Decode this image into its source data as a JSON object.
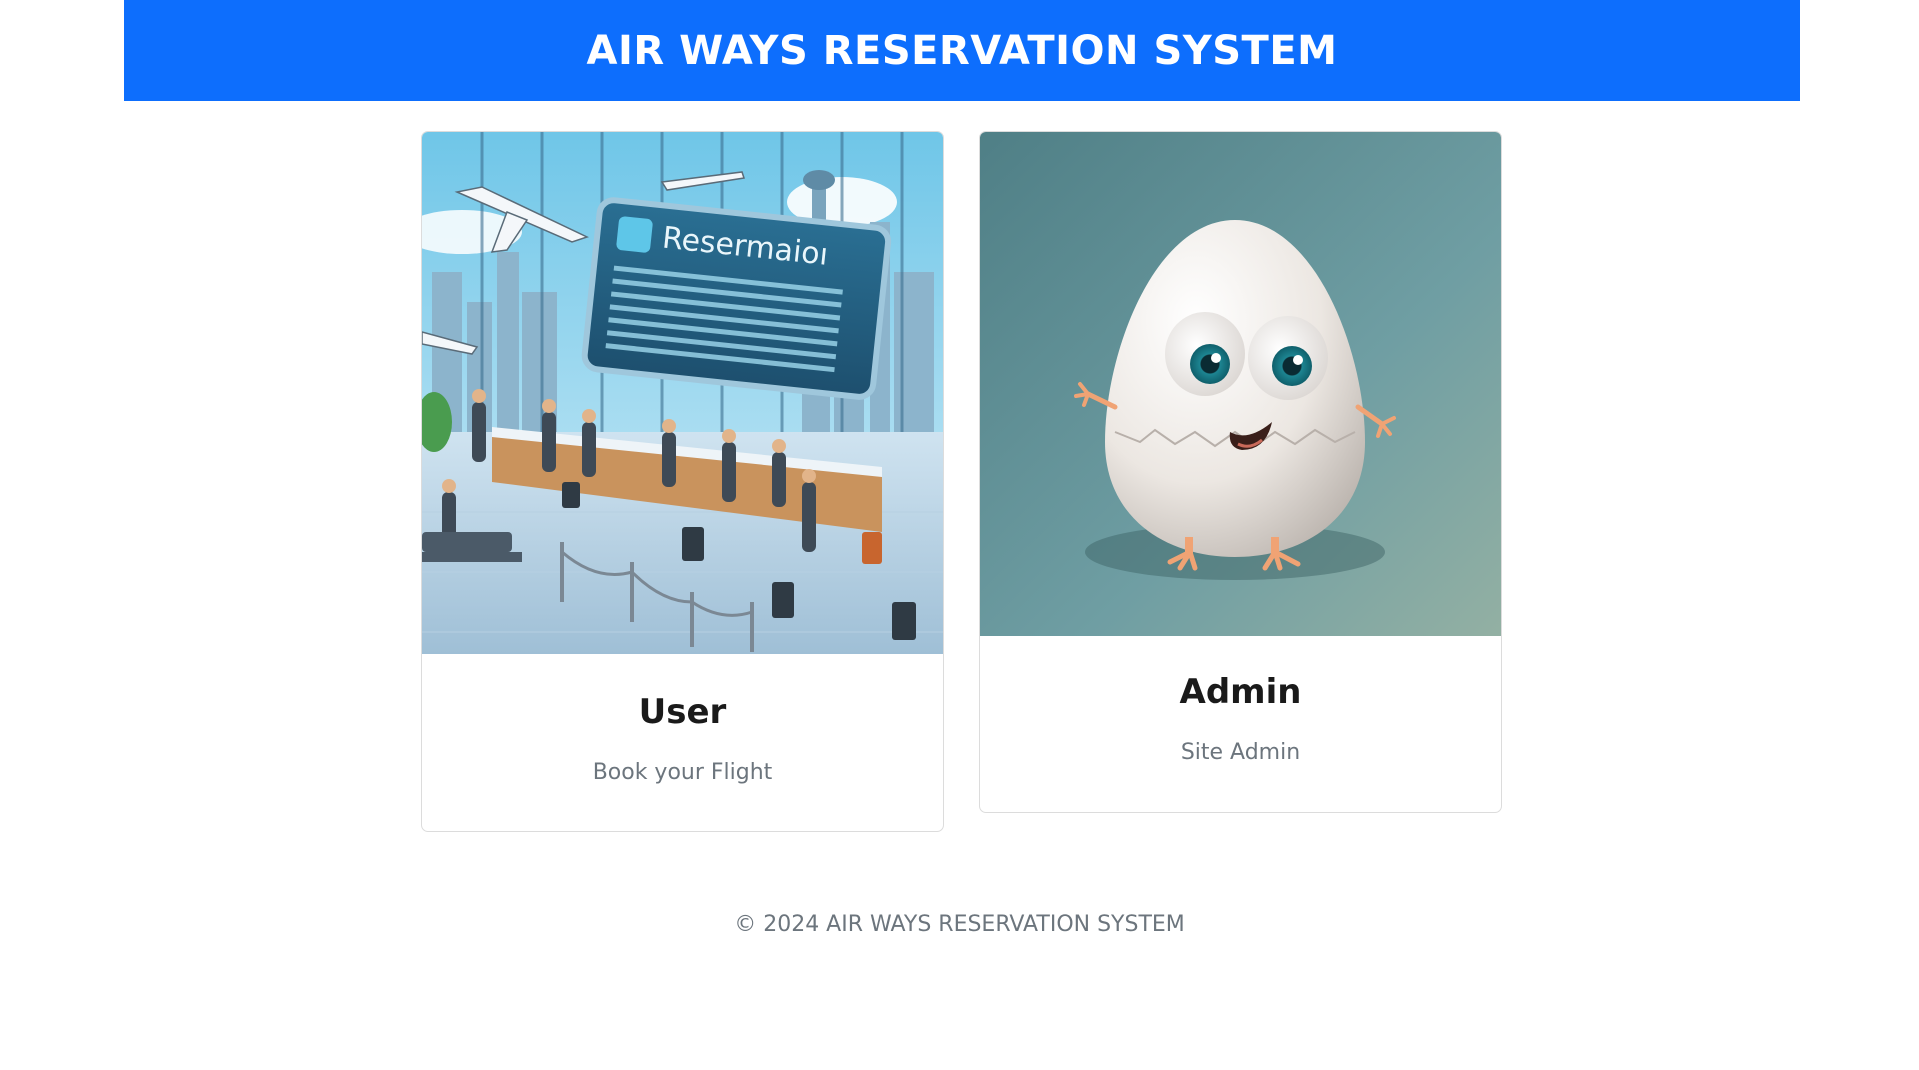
{
  "header": {
    "title": "AIR WAYS RESERVATION SYSTEM",
    "background": "#0d6efd"
  },
  "cards": [
    {
      "title": "User",
      "text": "Book your Flight",
      "image": {
        "icon": "airport-reservation-illustration",
        "board_text": "Resermaioı"
      }
    },
    {
      "title": "Admin",
      "text": "Site Admin",
      "image": {
        "icon": "egg-character-illustration"
      }
    }
  ],
  "footer": {
    "text": "© 2024 AIR WAYS RESERVATION SYSTEM"
  }
}
